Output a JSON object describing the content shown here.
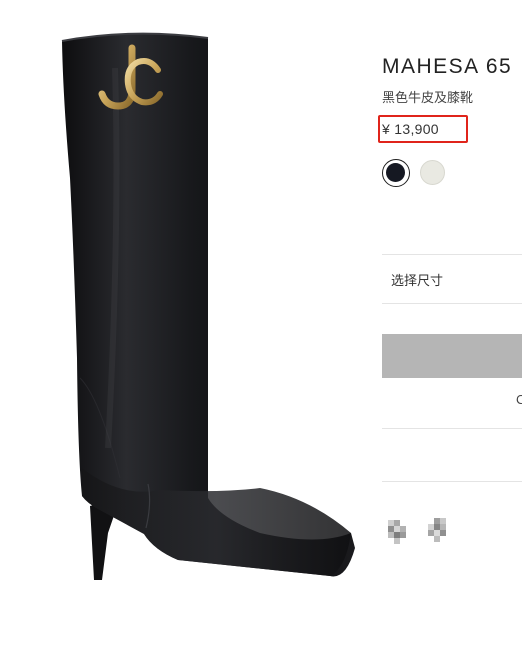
{
  "product": {
    "name": "MAHESA 65",
    "description": "黑色牛皮及膝靴",
    "price": "¥ 13,900",
    "image_icon": "knee-high-boot-image",
    "logo_icon": "jc-monogram-icon"
  },
  "colors": {
    "accent_highlight": "#e0241b",
    "swatch_black": "#151822",
    "swatch_white": "#e9e9e2",
    "button_disabled": "#b5b5b5"
  },
  "swatches": [
    {
      "name": "black",
      "selected": true
    },
    {
      "name": "white",
      "selected": false
    }
  ],
  "size_selector": {
    "label": "选择尺寸"
  },
  "share": {
    "icons": [
      "pixelated-icon",
      "pixelated-icon"
    ]
  }
}
